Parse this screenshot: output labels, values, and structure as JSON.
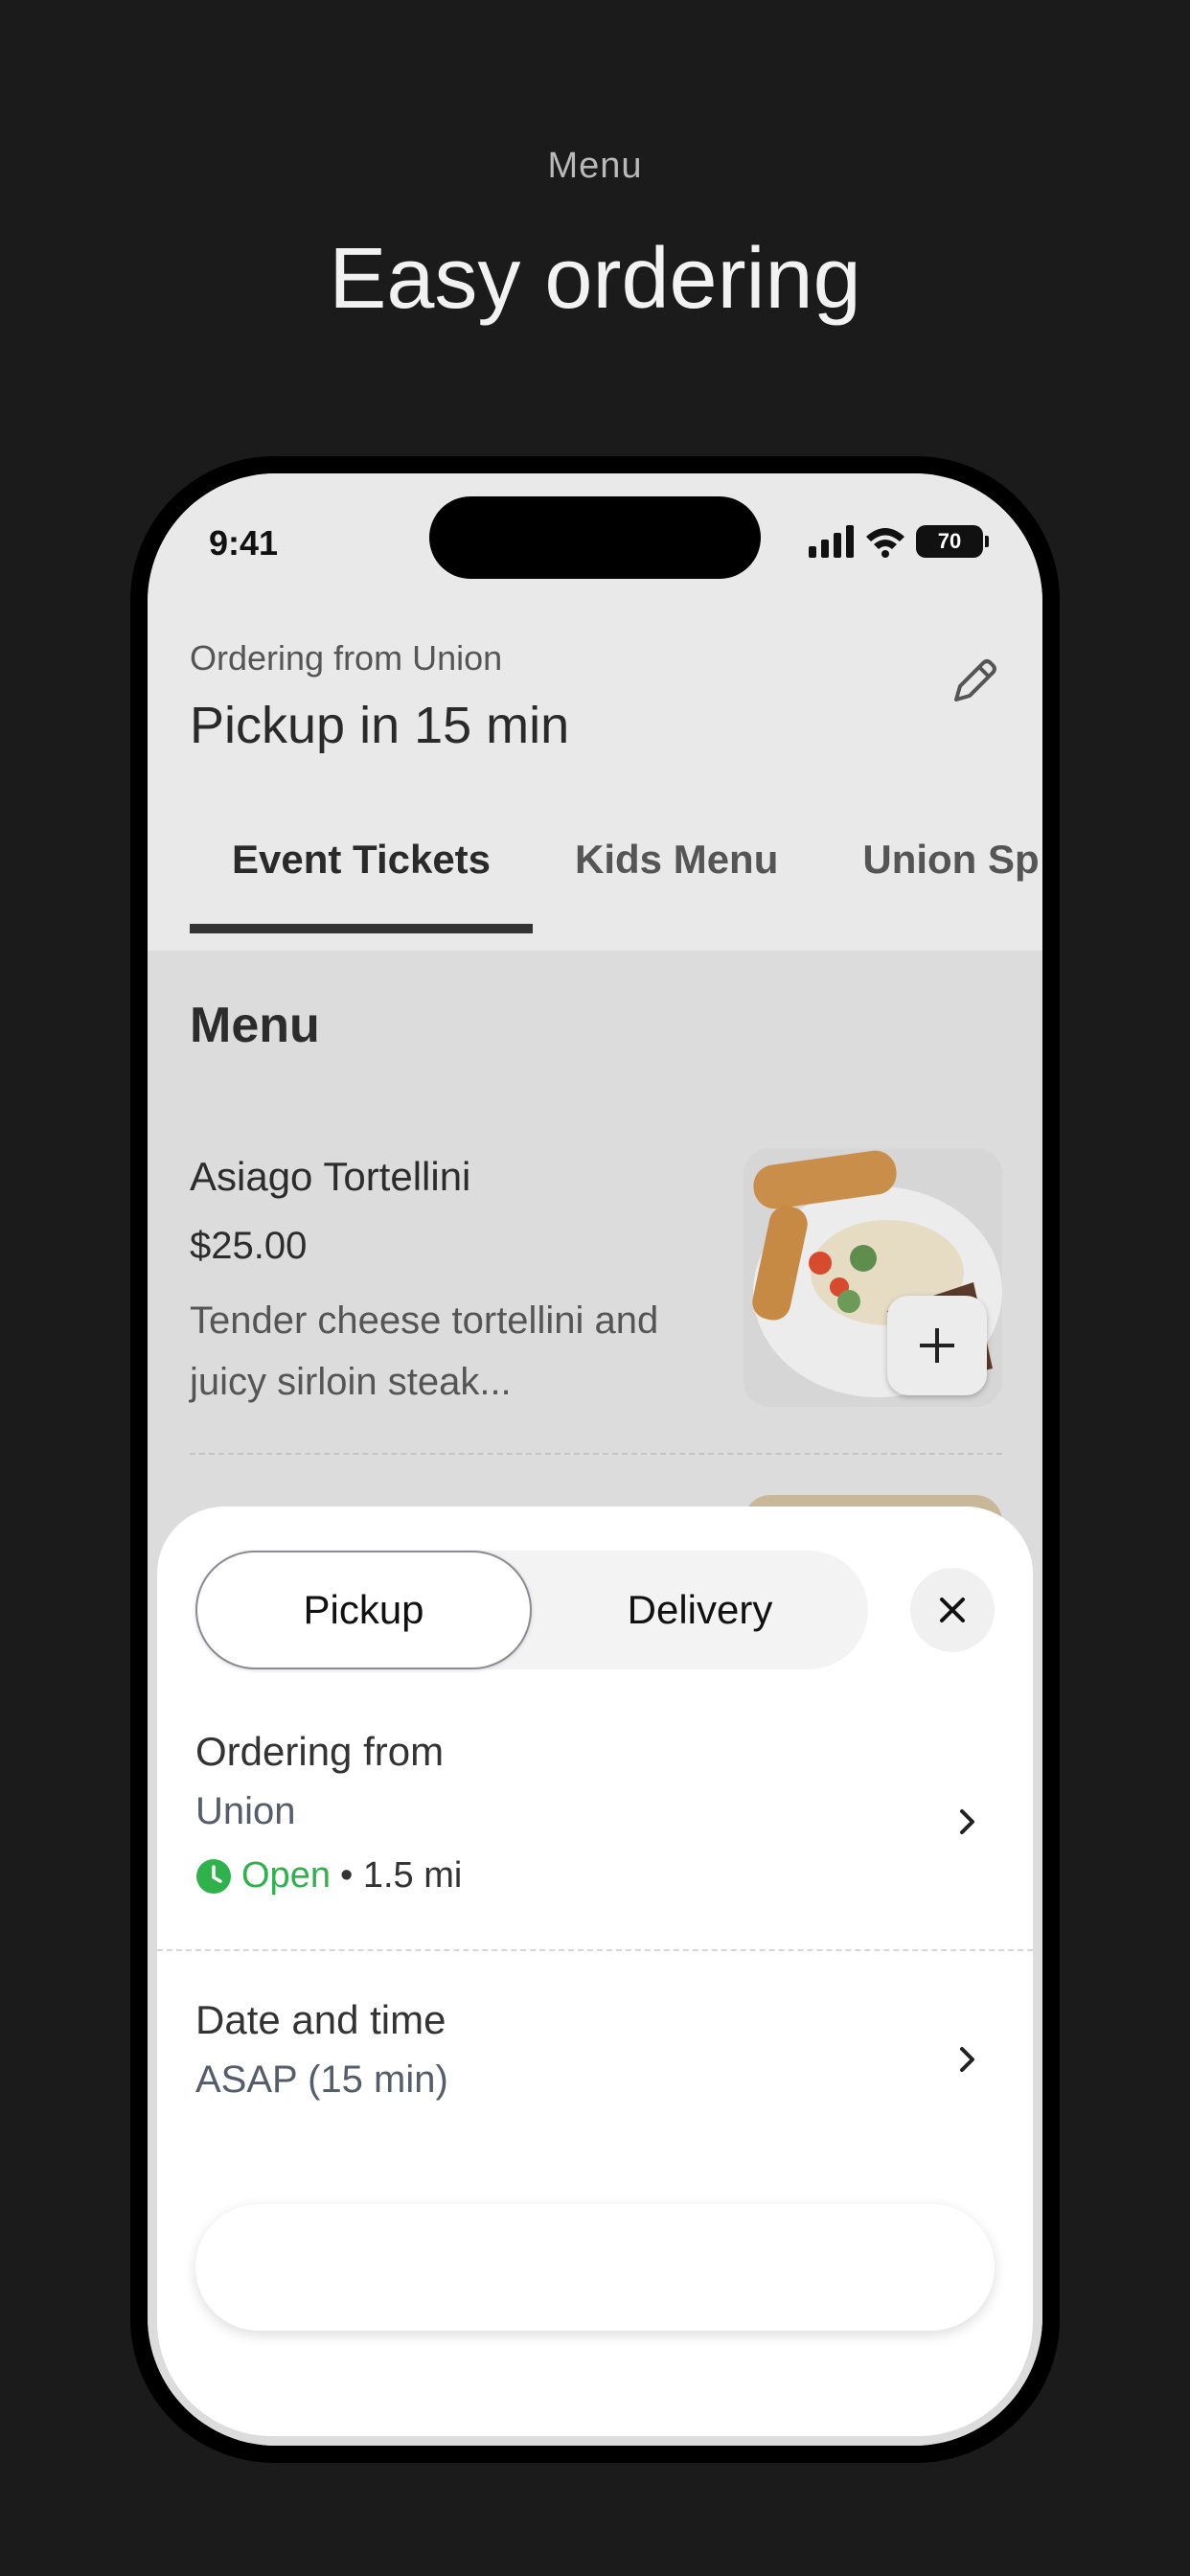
{
  "promo": {
    "eyebrow": "Menu",
    "title": "Easy ordering"
  },
  "status_bar": {
    "time": "9:41",
    "battery": "70"
  },
  "header": {
    "ordering_label": "Ordering from Union",
    "pickup_title": "Pickup in 15 min"
  },
  "tabs": [
    {
      "label": "Event Tickets",
      "active": true
    },
    {
      "label": "Kids Menu",
      "active": false
    },
    {
      "label": "Union Sp",
      "active": false
    }
  ],
  "menu": {
    "heading": "Menu",
    "items": [
      {
        "name": "Asiago Tortellini",
        "price": "$25.00",
        "description": "Tender cheese tortellini and juicy sirloin steak..."
      }
    ]
  },
  "sheet": {
    "modes": [
      "Pickup",
      "Delivery"
    ],
    "selected_mode": "Pickup",
    "ordering_from": {
      "title": "Ordering from",
      "location": "Union",
      "status": "Open",
      "distance": "• 1.5 mi"
    },
    "date_time": {
      "title": "Date and time",
      "value": "ASAP (15 min)"
    }
  },
  "colors": {
    "open_green": "#2fb24c",
    "background": "#1b1b1b"
  }
}
